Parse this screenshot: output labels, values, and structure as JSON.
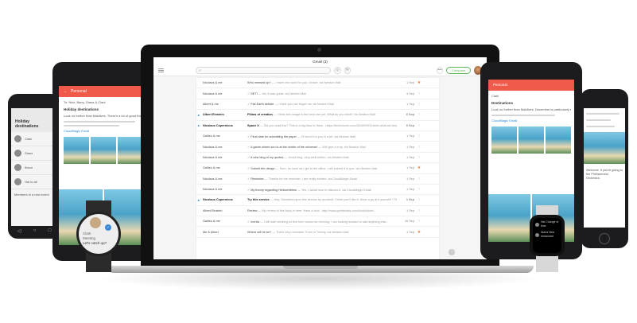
{
  "laptop": {
    "app_title": "Gmail (3)",
    "compose_label": "Compose",
    "more_label": "•••",
    "emails": [
      {
        "from": "Nicolaus & me",
        "thread": "",
        "subject": "Who messed up?",
        "preview": "I have one word for you: Oracle. via Newton Mail",
        "date": "1 Sep",
        "starred": true,
        "bold": false,
        "arrow": false,
        "tick": false
      },
      {
        "from": "Nicolaus & me",
        "thread": "",
        "subject": "SET!",
        "preview": "Ha, it was great. via Newton Mail",
        "date": "4 Sep",
        "starred": false,
        "bold": false,
        "arrow": false,
        "tick": true
      },
      {
        "from": "Albert & me",
        "thread": "",
        "subject": "Flat Earth debate",
        "preview": "I think you can forget me via Newton Mail",
        "date": "1 Sep",
        "starred": false,
        "bold": false,
        "arrow": false,
        "tick": true
      },
      {
        "from": "Albert Einstein",
        "thread": "",
        "subject": "Pillars of creation",
        "preview": "I think this image is the best one yet. What do you think? via Newton Mail",
        "date": "6 Sep",
        "starred": false,
        "bold": true,
        "arrow": true,
        "tick": false
      },
      {
        "from": "Nicolaus Copernicus",
        "thread": "",
        "subject": "Space X",
        "preview": "Did you read this? This is a big blow to them - https://techcrunch.com/2016/09/01/here-what-we-know...",
        "date": "6 Sep",
        "starred": false,
        "bold": true,
        "arrow": true,
        "tick": false
      },
      {
        "from": "Galileo & me",
        "thread": "",
        "subject": "Final date for submitting the paper",
        "preview": "I'll send it to you in a bit. via Newton Mail",
        "date": "1 Sep",
        "starred": false,
        "bold": false,
        "arrow": false,
        "tick": true
      },
      {
        "from": "Nicolaus & me",
        "thread": "",
        "subject": "A game where sun is at the center of the universe!",
        "preview": "Will give it a try. via Newton Mail",
        "date": "1 Sep",
        "starred": false,
        "bold": false,
        "arrow": false,
        "tick": true
      },
      {
        "from": "Nicolaus & me",
        "thread": "",
        "subject": "A new blog of my quotes",
        "preview": "Great blog. Very well written. via Newton Mail",
        "date": "1 Sep",
        "starred": false,
        "bold": false,
        "arrow": false,
        "tick": true
      },
      {
        "from": "Galileo & me",
        "thread": "",
        "subject": "Submit the design",
        "preview": "Sure. As soon as I get to the office, I will submit it to you. via Newton Mail",
        "date": "1 Sep",
        "starred": true,
        "bold": false,
        "arrow": false,
        "tick": true
      },
      {
        "from": "Nicolaus & me",
        "thread": "",
        "subject": "Reminder",
        "preview": "Thanks for the reminder. I am really excited. via CloudMagic Email",
        "date": "1 Sep",
        "starred": false,
        "bold": false,
        "arrow": false,
        "tick": true
      },
      {
        "from": "Nicolaus & me",
        "thread": "",
        "subject": "My theory regarding Heliocentrism",
        "preview": "Yes, I would love to discuss it. via CloudMagic Email",
        "date": "1 Sep",
        "starred": false,
        "bold": false,
        "arrow": false,
        "tick": true
      },
      {
        "from": "Nicolaus Copernicus",
        "thread": "",
        "subject": "Try this service",
        "preview": "Hey, Stumbled upon this service by accident. I think you'll like it. Have a go at it yourself ! Thanks...",
        "date": "1 Sep",
        "starred": false,
        "bold": true,
        "arrow": true,
        "tick": false
      },
      {
        "from": "Albert Einstein",
        "thread": "",
        "subject": "Review",
        "preview": "My review of this book is here. Have a look - http://www.goodreads.com/book/show/...",
        "date": "1 Sep",
        "starred": false,
        "bold": false,
        "arrow": false,
        "tick": false
      },
      {
        "from": "Galileo & me",
        "thread": "",
        "subject": "Inertia",
        "preview": "I will start working on this from tomorrow morning. I am looking forward to add anything else...",
        "date": "26 Sep",
        "starred": false,
        "bold": false,
        "arrow": false,
        "tick": true
      },
      {
        "from": "Me & Albert",
        "thread": "",
        "subject": "Where will he be?",
        "preview": "That's very uncertain. Even in Theory. via Newton Mail",
        "date": "1 Sep",
        "starred": true,
        "bold": false,
        "arrow": false,
        "tick": false
      }
    ]
  },
  "phone_left": {
    "title": "Holiday destinations",
    "contacts": [
      "Clark",
      "Diana",
      "Bruce",
      "Hal to all"
    ],
    "snippet": "Members in a new event",
    "nav": [
      "◁",
      "○",
      "□"
    ]
  },
  "tablet_left": {
    "folder": "Personal",
    "to_line": "To: Nick, Barry, Diana & Clark",
    "subject": "Holiday destinations",
    "body": "Look no further than Maldives. There's a lot of good things...",
    "link_text": "CloudMagic Email"
  },
  "watch_round": {
    "badge": "✓",
    "line1": "Clark",
    "line2": "Meeting",
    "line3": "Let's catch up?"
  },
  "tablet_right": {
    "folder": "Personal",
    "sender": "Clark",
    "subject": "Destinations",
    "body": "Look no further than Maldives. December is particularly special to enjoy the",
    "link_text": "CloudMagic Email"
  },
  "phone_right": {
    "snippet": "Welcome. If you're going to the Philharmonic Orchestra."
  },
  "watch_square": {
    "row1": "Hal Change of time",
    "row2": "Diana New restaurant"
  },
  "colors": {
    "accent_red": "#ef5a4a",
    "compose_green": "#5cb85c",
    "star_orange": "#ef7a3a",
    "link_blue": "#2b88d8"
  }
}
